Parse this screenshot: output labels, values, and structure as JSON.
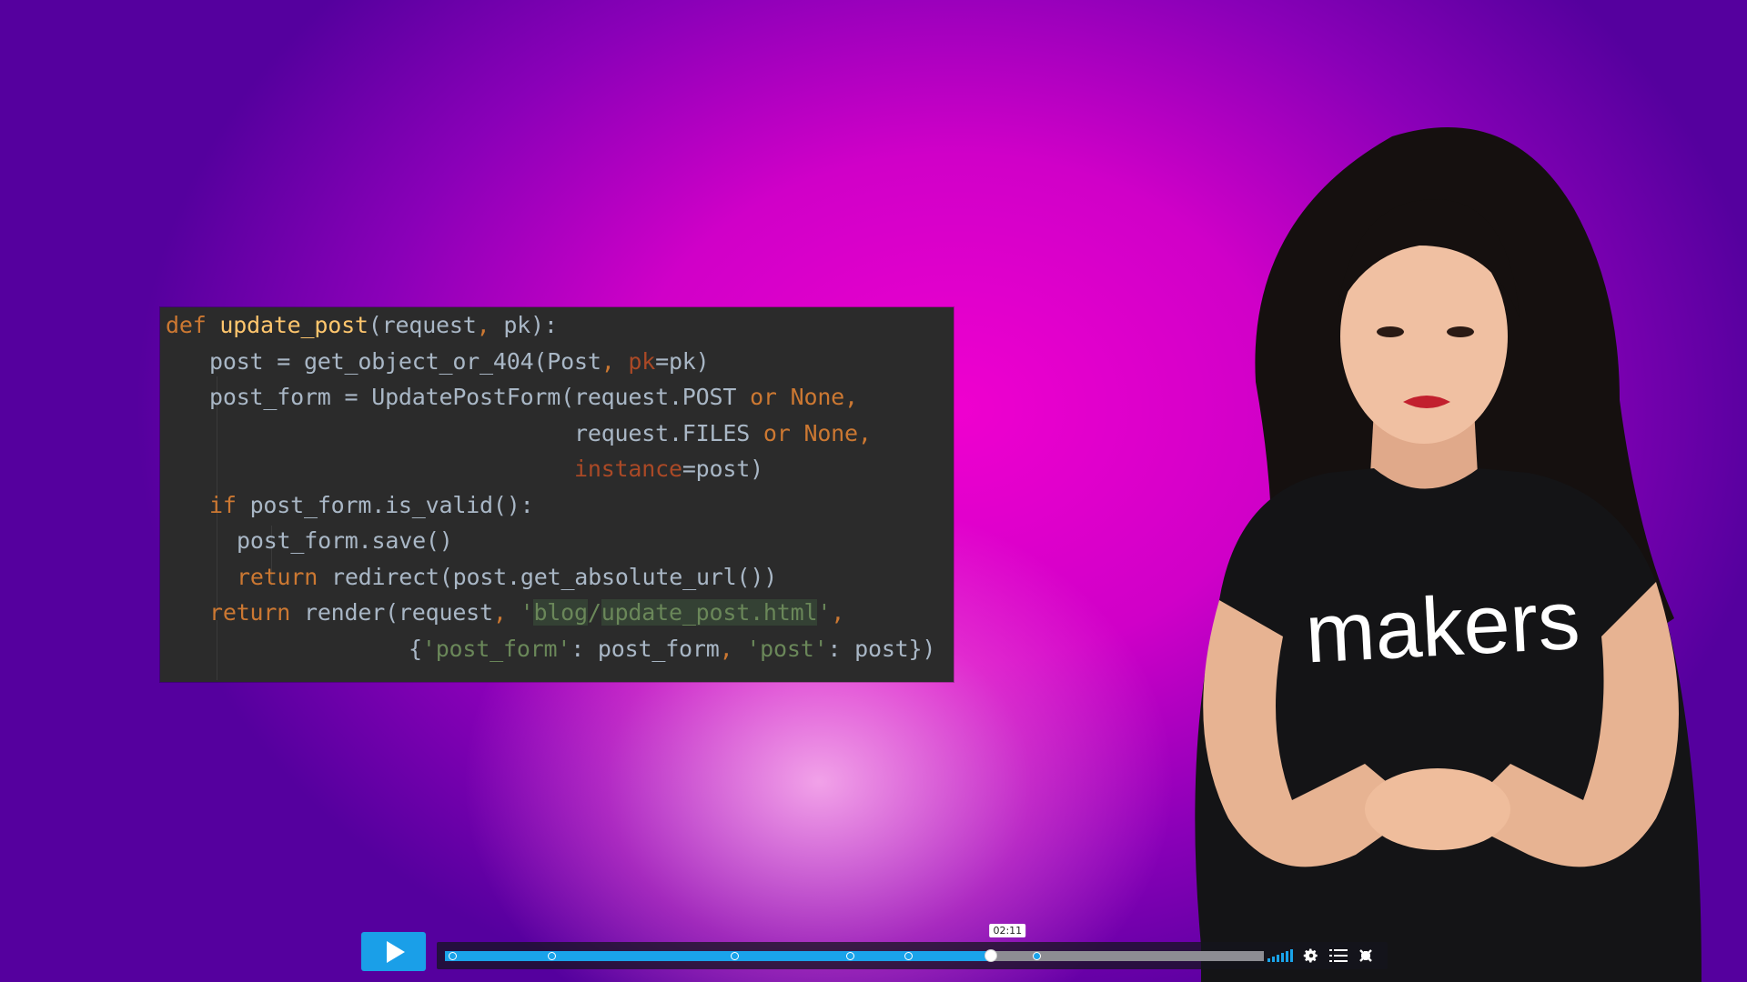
{
  "code": {
    "lines": [
      {
        "indent": 0,
        "tokens": [
          {
            "t": "def",
            "c": "kw"
          },
          {
            "t": " "
          },
          {
            "t": "update_post",
            "c": "fn"
          },
          {
            "t": "(request"
          },
          {
            "t": ", ",
            "c": "kw"
          },
          {
            "t": "pk):"
          }
        ]
      },
      {
        "indent": 1,
        "tokens": [
          {
            "t": "post = get_object_or_404(Post"
          },
          {
            "t": ", ",
            "c": "kw"
          },
          {
            "t": "pk",
            "c": "param"
          },
          {
            "t": "=pk)"
          }
        ]
      },
      {
        "indent": 1,
        "tokens": [
          {
            "t": "post_form = UpdatePostForm(request.POST "
          },
          {
            "t": "or None,",
            "c": "kw"
          }
        ]
      },
      {
        "indent": 6,
        "tokens": [
          {
            "t": "request.FILES "
          },
          {
            "t": "or None,",
            "c": "kw"
          }
        ]
      },
      {
        "indent": 6,
        "tokens": [
          {
            "t": "instance",
            "c": "param"
          },
          {
            "t": "=post)"
          }
        ]
      },
      {
        "indent": 1,
        "tokens": [
          {
            "t": "if ",
            "c": "kw"
          },
          {
            "t": "post_form.is_valid():"
          }
        ]
      },
      {
        "indent": 2,
        "tokens": [
          {
            "t": "post_form.save()"
          }
        ]
      },
      {
        "indent": 2,
        "tokens": [
          {
            "t": "return ",
            "c": "kw"
          },
          {
            "t": "redirect(post.get_absolute_url())"
          }
        ]
      },
      {
        "indent": 1,
        "tokens": [
          {
            "t": "return ",
            "c": "kw"
          },
          {
            "t": "render(request"
          },
          {
            "t": ", ",
            "c": "kw"
          },
          {
            "t": "'",
            "c": "str"
          },
          {
            "t": "blog",
            "c": "str hl"
          },
          {
            "t": "/",
            "c": "str"
          },
          {
            "t": "update_post.html",
            "c": "str hl"
          },
          {
            "t": "'",
            "c": "str"
          },
          {
            "t": ",",
            "c": "kw"
          }
        ]
      },
      {
        "indent": 4,
        "tokens": [
          {
            "t": "{"
          },
          {
            "t": "'post_form'",
            "c": "str"
          },
          {
            "t": ": post_form"
          },
          {
            "t": ", ",
            "c": "kw"
          },
          {
            "t": "'post'",
            "c": "str"
          },
          {
            "t": ": post})"
          }
        ]
      }
    ]
  },
  "shirt_logo": "makers",
  "player": {
    "current_time": "02:11",
    "progress_fraction": 0.667,
    "chapter_marker_fractions": [
      0.01,
      0.131,
      0.354,
      0.495,
      0.567,
      0.723
    ]
  },
  "colors": {
    "accent": "#1aa3ea",
    "code_bg": "#2b2b2b",
    "background_magenta": "#ef00cf"
  },
  "icons": [
    "play-icon",
    "volume-icon",
    "settings-gear-icon",
    "chapters-list-icon",
    "fullscreen-exit-icon"
  ]
}
